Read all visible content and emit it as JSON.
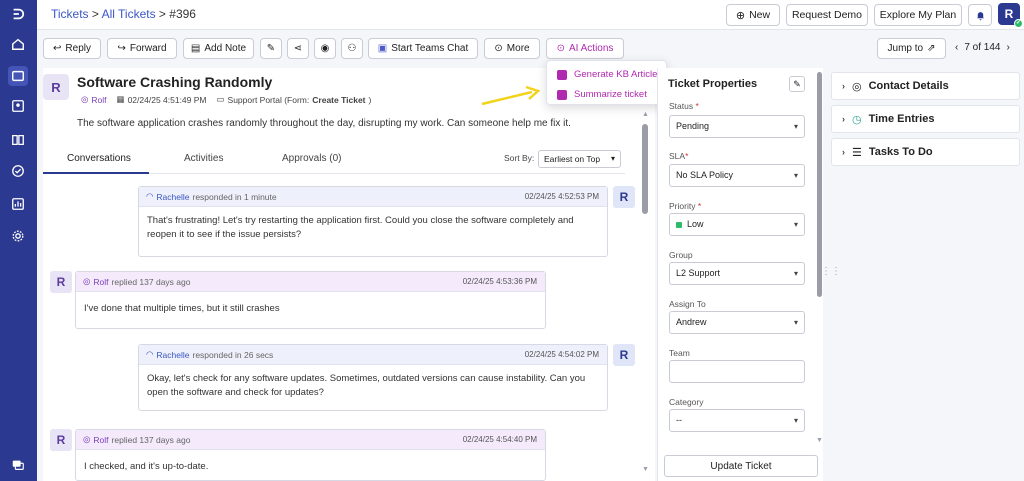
{
  "sidebar": {
    "items": [
      {
        "name": "logo",
        "icon": "logo-icon"
      },
      {
        "name": "home",
        "icon": "home-icon"
      },
      {
        "name": "tickets",
        "icon": "ticket-icon",
        "active": true
      },
      {
        "name": "contacts",
        "icon": "contact-icon"
      },
      {
        "name": "knowledge-base",
        "icon": "book-icon"
      },
      {
        "name": "tasks",
        "icon": "check-circle-icon"
      },
      {
        "name": "reports",
        "icon": "chart-icon"
      },
      {
        "name": "settings",
        "icon": "gear-icon"
      },
      {
        "name": "chat",
        "icon": "chat-icon"
      }
    ]
  },
  "breadcrumb": {
    "tickets": "Tickets",
    "sep1": " > ",
    "all_tickets": "All Tickets",
    "sep2": " > ",
    "current": "#396"
  },
  "topbar": {
    "new_label": "New",
    "request_demo_label": "Request Demo",
    "explore_plan_label": "Explore My Plan",
    "avatar_initial": "R"
  },
  "toolbar": {
    "reply": "Reply",
    "forward": "Forward",
    "add_note": "Add Note",
    "teams_chat": "Start Teams Chat",
    "more": "More",
    "ai_actions": "AI Actions",
    "jump_to": "Jump to",
    "pagination": "7 of 144"
  },
  "ai_menu": {
    "items": [
      "Generate KB Article",
      "Summarize ticket"
    ]
  },
  "ticket": {
    "avatar": "R",
    "title": "Software Crashing Randomly",
    "requester": "Rolf",
    "created": "02/24/25 4:51:49 PM",
    "source_prefix": "Support Portal (Form: ",
    "source_form": "Create Ticket",
    "source_suffix": ")",
    "description": "The software application crashes randomly throughout the day, disrupting my work. Can someone help me fix it."
  },
  "tabs": {
    "conversations": "Conversations",
    "activities": "Activities",
    "approvals": "Approvals (0)",
    "sort_by": "Sort By:",
    "sort_value": "Earliest on Top"
  },
  "conversation": [
    {
      "author": "Rachelle",
      "verb": "responded in 1 minute",
      "time": "02/24/25 4:52:53 PM",
      "body": "That's frustrating! Let's try restarting the application first. Could you close the software completely and reopen it to see if the issue persists?",
      "avatar": "R",
      "type": "agent"
    },
    {
      "author": "Rolf",
      "verb": "replied 137 days ago",
      "time": "02/24/25 4:53:36 PM",
      "body": "I've done that multiple times, but it still crashes",
      "avatar": "R",
      "type": "customer"
    },
    {
      "author": "Rachelle",
      "verb": "responded in 26 secs",
      "time": "02/24/25 4:54:02 PM",
      "body": "Okay, let's check for any software updates. Sometimes, outdated versions can cause instability. Can you open the software and check for updates?",
      "avatar": "R",
      "type": "agent"
    },
    {
      "author": "Rolf",
      "verb": "replied 137 days ago",
      "time": "02/24/25 4:54:40 PM",
      "body": "I checked, and it's up-to-date.",
      "avatar": "R",
      "type": "customer"
    }
  ],
  "properties": {
    "title": "Ticket Properties",
    "status_label": "Status",
    "status_value": "Pending",
    "sla_label": "SLA",
    "sla_value": "No SLA Policy",
    "priority_label": "Priority",
    "priority_value": "Low",
    "group_label": "Group",
    "group_value": "L2 Support",
    "assign_label": "Assign To",
    "assign_value": "Andrew",
    "team_label": "Team",
    "team_value": "",
    "category_label": "Category",
    "category_value": "--",
    "update_button": "Update Ticket",
    "required_mark": "*"
  },
  "accordion": {
    "contact_details": "Contact Details",
    "time_entries": "Time Entries",
    "tasks_to_do": "Tasks To Do"
  },
  "colors": {
    "sidebar": "#2b3990",
    "accent": "#3a57c5",
    "ai": "#b02ab0",
    "arrow": "#f2d31b",
    "priority_low": "#2dbb6b"
  }
}
